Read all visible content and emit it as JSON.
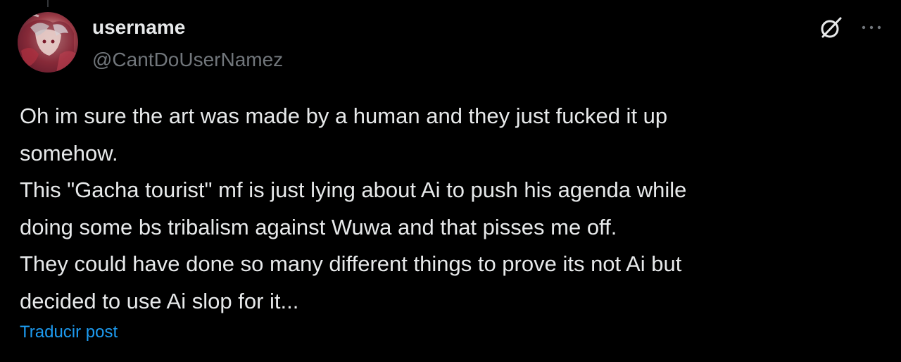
{
  "post": {
    "author": {
      "display_name": "username",
      "handle": "@CantDoUserNamez",
      "avatar_icon": "avatar-image"
    },
    "text_lines": [
      "Oh im sure the art was made by a human and they just fucked it up",
      "somehow.",
      "This \"Gacha tourist\" mf is just lying about Ai to push his agenda while",
      "doing some bs tribalism against Wuwa and that pisses me off.",
      "They could have done so many different things to prove its not Ai but",
      "decided to use Ai slop for it..."
    ],
    "translate_label": "Traducir post",
    "icons": {
      "grok": "grok-icon",
      "more": "more-options-icon"
    }
  },
  "colors": {
    "background": "#000000",
    "primary_text": "#e7e9ea",
    "secondary_text": "#71767b",
    "link": "#1d9bf0"
  }
}
